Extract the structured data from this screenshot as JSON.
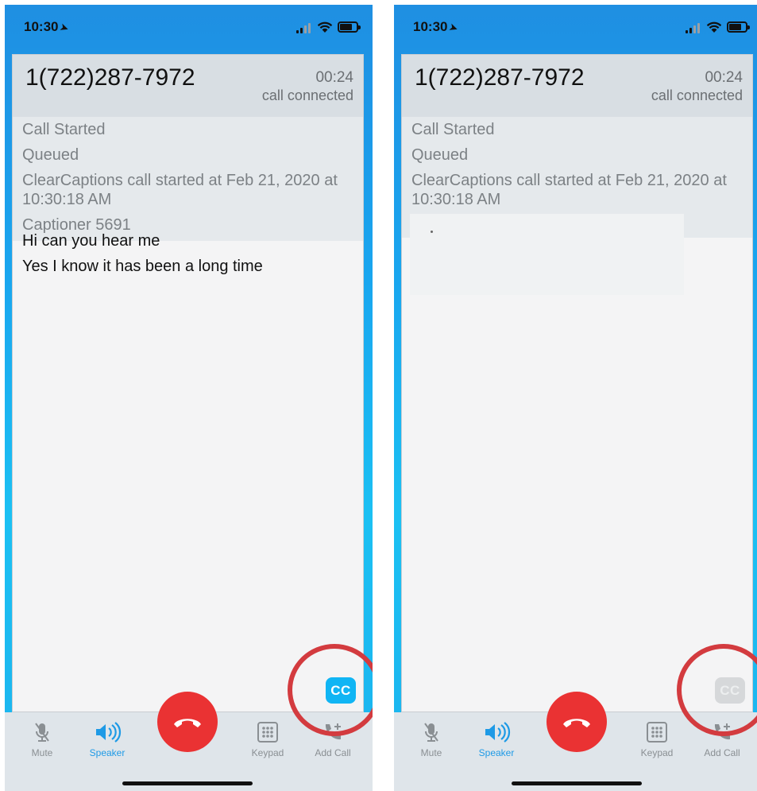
{
  "screens": [
    {
      "status_bar": {
        "time": "10:30",
        "location_icon": "location-arrow-icon"
      },
      "call": {
        "number": "1(722)287-7972",
        "timer": "00:24",
        "status": "call connected",
        "log": [
          "Call Started",
          "Queued",
          "ClearCaptions call started at Feb 21, 2020 at 10:30:18 AM",
          "Captioner 5691"
        ],
        "captions": [
          "Hi can you hear me",
          "Yes I know it has been a long time"
        ],
        "cc_label": "CC",
        "cc_state": "on"
      },
      "toolbar": {
        "mute": "Mute",
        "speaker": "Speaker",
        "keypad": "Keypad",
        "add_call": "Add Call"
      }
    },
    {
      "status_bar": {
        "time": "10:30",
        "location_icon": "location-arrow-icon"
      },
      "call": {
        "number": "1(722)287-7972",
        "timer": "00:24",
        "status": "call connected",
        "log": [
          "Call Started",
          "Queued",
          "ClearCaptions call started at Feb 21, 2020 at 10:30:18 AM"
        ],
        "captions": [],
        "cc_label": "CC",
        "cc_state": "off"
      },
      "toolbar": {
        "mute": "Mute",
        "speaker": "Speaker",
        "keypad": "Keypad",
        "add_call": "Add Call"
      }
    }
  ],
  "colors": {
    "accent": "#1e9ae6",
    "cc_on": "#10b5f4",
    "cc_off": "#d6d8da",
    "end_call": "#ea3233",
    "highlight": "#d33b3f"
  }
}
